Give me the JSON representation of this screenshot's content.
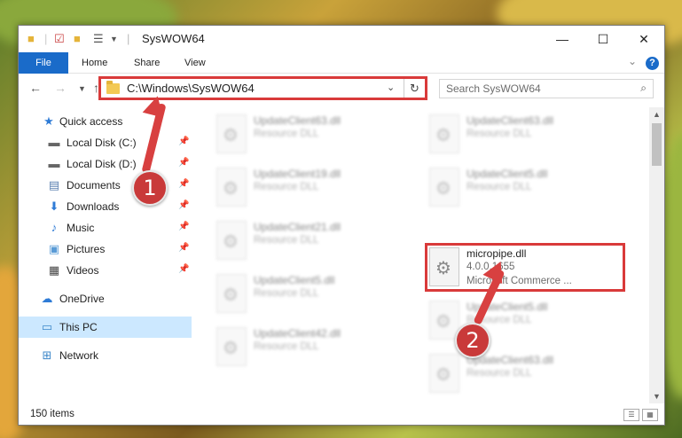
{
  "window": {
    "title": "SysWOW64",
    "minimize": "—",
    "maximize": "☐",
    "close": "✕"
  },
  "ribbon": {
    "tabs": [
      "File",
      "Home",
      "Share",
      "View"
    ]
  },
  "address": {
    "path": "C:\\Windows\\SysWOW64",
    "search_placeholder": "Search SysWOW64"
  },
  "sidebar": {
    "items": [
      {
        "label": "Quick access",
        "icon": "star-icon",
        "pinned": false
      },
      {
        "label": "Local Disk (C:)",
        "icon": "drive-icon",
        "pinned": true
      },
      {
        "label": "Local Disk (D:)",
        "icon": "drive-icon",
        "pinned": true
      },
      {
        "label": "Documents",
        "icon": "documents-icon",
        "pinned": true
      },
      {
        "label": "Downloads",
        "icon": "downloads-icon",
        "pinned": true
      },
      {
        "label": "Music",
        "icon": "music-icon",
        "pinned": true
      },
      {
        "label": "Pictures",
        "icon": "pictures-icon",
        "pinned": true
      },
      {
        "label": "Videos",
        "icon": "videos-icon",
        "pinned": true
      },
      {
        "label": "OneDrive",
        "icon": "cloud-icon",
        "pinned": false
      },
      {
        "label": "This PC",
        "icon": "computer-icon",
        "pinned": false,
        "selected": true
      },
      {
        "label": "Network",
        "icon": "network-icon",
        "pinned": false
      }
    ]
  },
  "files": [
    {
      "name": "UpdateClient63.dll",
      "meta1": "Resource DLL"
    },
    {
      "name": "UpdateClient63.dll",
      "meta1": "Resource DLL"
    },
    {
      "name": "UpdateClient19.dll",
      "meta1": "Resource DLL"
    },
    {
      "name": "UpdateClient5.dll",
      "meta1": "Resource DLL"
    },
    {
      "name": "UpdateClient21.dll",
      "meta1": "Resource DLL"
    },
    {
      "name": "micropipe.dll",
      "meta1": "4.0.0.1655",
      "meta2": "Microsoft Commerce ..."
    },
    {
      "name": "UpdateClient5.dll",
      "meta1": "Resource DLL"
    },
    {
      "name": "UpdateClient5.dll",
      "meta1": "Resource DLL"
    },
    {
      "name": "UpdateClient42.dll",
      "meta1": "Resource DLL"
    },
    {
      "name": "UpdateClient63.dll",
      "meta1": "Resource DLL"
    }
  ],
  "status": {
    "item_count": "150 items"
  },
  "annotations": {
    "step1": "1",
    "step2": "2",
    "highlight_color": "#d93a3a"
  },
  "colors": {
    "accent": "#1a6bc9",
    "selected_bg": "#cce8ff"
  }
}
